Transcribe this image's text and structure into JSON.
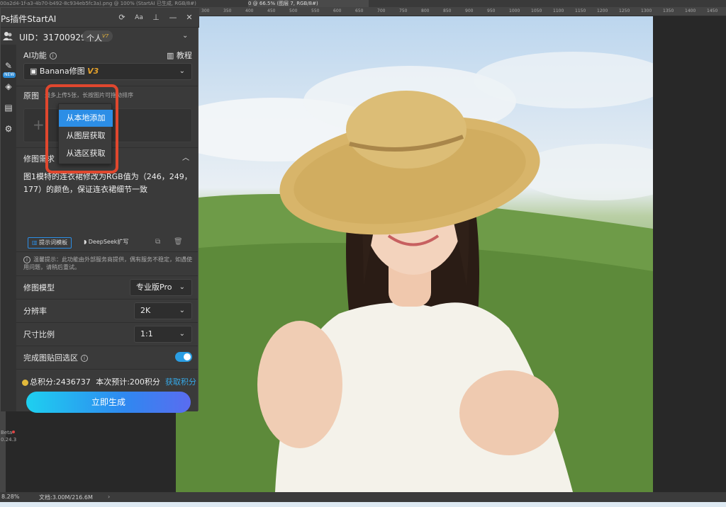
{
  "ps": {
    "tab1": "00a2d4-1f-a3-4b70-b492-8c934eb5fc3a).png @ 100% (StartAI 已生成, RGB/8#)",
    "tab2": "0 @ 66.5% (图层 7, RGB/8#)",
    "ruler_ticks": [
      "300",
      "350",
      "400",
      "450",
      "500",
      "550",
      "600",
      "650",
      "700",
      "750",
      "800",
      "850",
      "900",
      "950",
      "1000",
      "1050",
      "1100",
      "1150",
      "1200",
      "1250",
      "1300",
      "1350",
      "1400",
      "1450",
      "1500"
    ],
    "zoom": "8.28%",
    "doc_size": "文档:3.00M/216.6M"
  },
  "panel": {
    "title": "Ps插件StartAI",
    "refresh_icon": "refresh-icon",
    "font_size_label": "Aa",
    "pin_icon": "pin-icon",
    "minimize_icon": "minimize-icon",
    "close_icon": "close-icon"
  },
  "user": {
    "uid": "UID：317009291",
    "tier": "个人",
    "tier_level": "V7"
  },
  "sidebar": {
    "new_badge": "NEW",
    "beta": "Beta",
    "version": "0.24.3"
  },
  "ai_function": {
    "label": "AI功能",
    "tutorial": "教程",
    "selected": "Banana修图",
    "version": "V3"
  },
  "original": {
    "label": "原图",
    "hint": "最多上传5张，长按图片可拖动排序"
  },
  "dropdown": {
    "items": [
      "从本地添加",
      "从图层获取",
      "从选区获取"
    ]
  },
  "requirement": {
    "label": "修图需求",
    "text": "图1模特的连衣裙修改为RGB值为（246，249，177）的颜色，保证连衣裙细节一致",
    "template_btn": "提示词模板",
    "deepseek_btn": "DeepSeek扩写"
  },
  "notice": "温馨提示：此功能由外部服务商提供，偶有服务不稳定，如遇使用问题，请稍后重试。",
  "settings": {
    "model_label": "修图模型",
    "model_value": "专业版Pro",
    "resolution_label": "分辨率",
    "resolution_value": "2K",
    "ratio_label": "尺寸比例",
    "ratio_value": "1:1",
    "paste_label": "完成图贴回选区",
    "paste_enabled": true
  },
  "points": {
    "total": "总积分:2436737",
    "estimate": "本次预计:200积分",
    "get": "获取积分"
  },
  "generate_btn": "立即生成",
  "colors": {
    "accent": "#2c8ee6",
    "highlight": "#e0472e",
    "gradient_start": "#1ed0f0",
    "gradient_end": "#5a6cf0"
  }
}
